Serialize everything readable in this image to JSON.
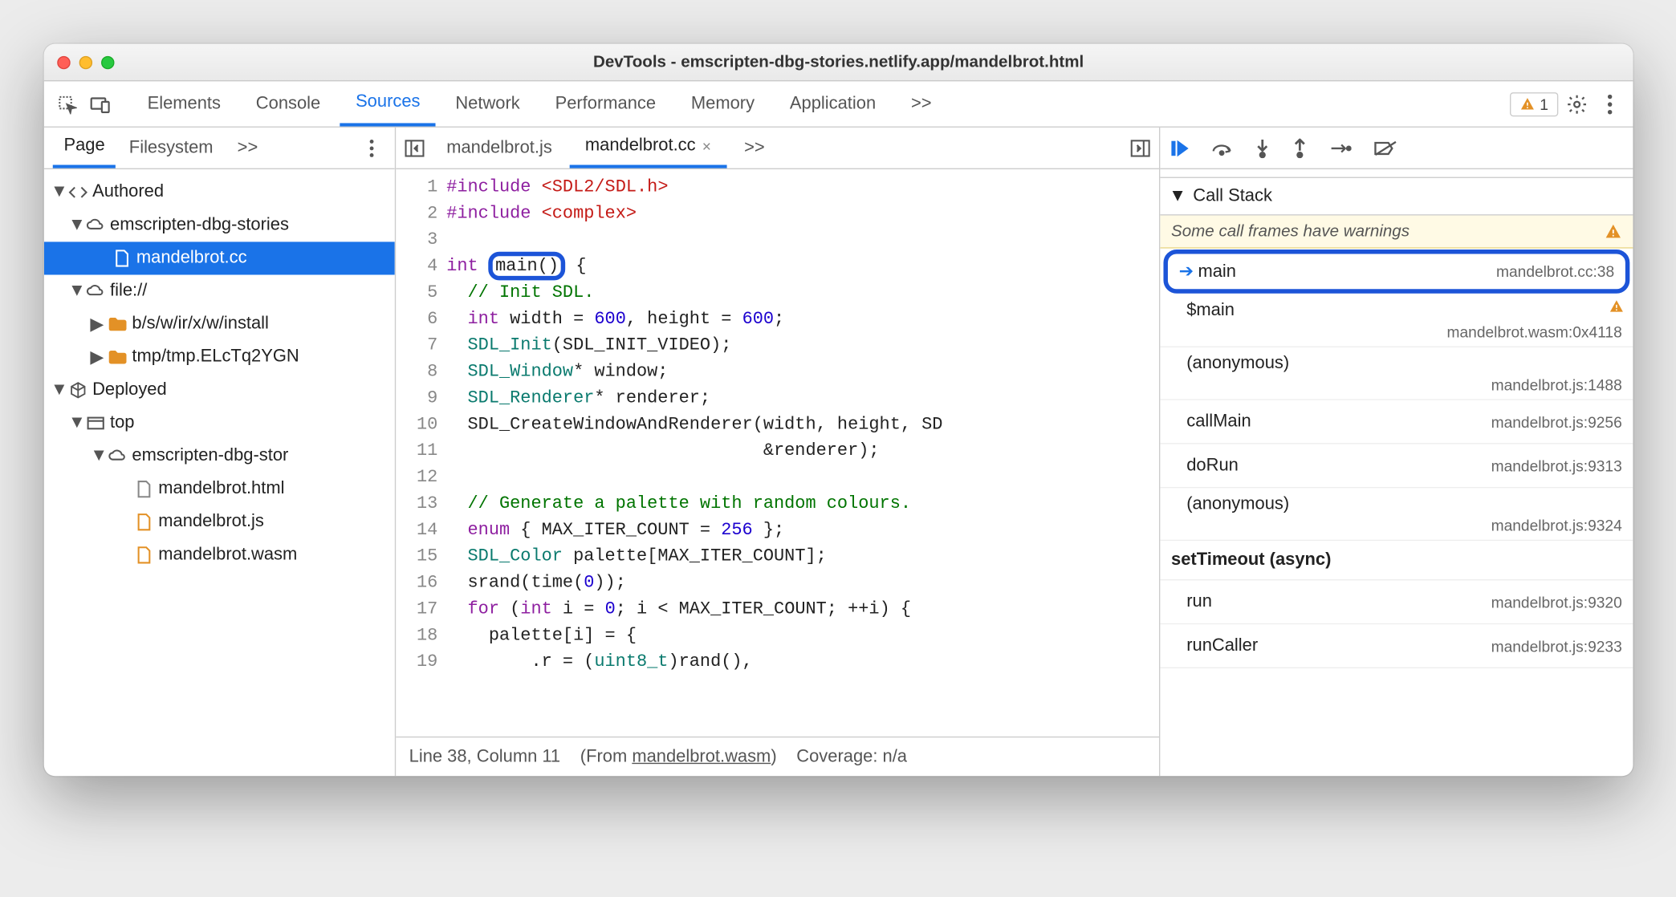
{
  "window": {
    "title": "DevTools - emscripten-dbg-stories.netlify.app/mandelbrot.html"
  },
  "topTabs": {
    "elements": "Elements",
    "console": "Console",
    "sources": "Sources",
    "network": "Network",
    "performance": "Performance",
    "memory": "Memory",
    "application": "Application",
    "more": ">>",
    "warnCount": "1"
  },
  "navTabs": {
    "page": "Page",
    "filesystem": "Filesystem",
    "more": ">>"
  },
  "tree": {
    "authored": "Authored",
    "origin1": "emscripten-dbg-stories",
    "file_mc": "mandelbrot.cc",
    "file_proto": "file://",
    "dir1": "b/s/w/ir/x/w/install",
    "dir2": "tmp/tmp.ELcTq2YGN",
    "deployed": "Deployed",
    "top": "top",
    "origin2": "emscripten-dbg-stor",
    "f_html": "mandelbrot.html",
    "f_js": "mandelbrot.js",
    "f_wasm": "mandelbrot.wasm"
  },
  "srcTabs": {
    "t1": "mandelbrot.js",
    "t2": "mandelbrot.cc",
    "more": ">>"
  },
  "code": {
    "lines": [
      "#include <SDL2/SDL.h>",
      "#include <complex>",
      "",
      "int main() {",
      "  // Init SDL.",
      "  int width = 600, height = 600;",
      "  SDL_Init(SDL_INIT_VIDEO);",
      "  SDL_Window* window;",
      "  SDL_Renderer* renderer;",
      "  SDL_CreateWindowAndRenderer(width, height, SD",
      "                              &renderer);",
      "",
      "  // Generate a palette with random colours.",
      "  enum { MAX_ITER_COUNT = 256 };",
      "  SDL_Color palette[MAX_ITER_COUNT];",
      "  srand(time(0));",
      "  for (int i = 0; i < MAX_ITER_COUNT; ++i) {",
      "    palette[i] = {",
      "        .r = (uint8_t)rand(),"
    ]
  },
  "status": {
    "pos": "Line 38, Column 11",
    "from_pre": "(From ",
    "from_link": "mandelbrot.wasm",
    "from_post": ")",
    "cov": "Coverage: n/a"
  },
  "callstack": {
    "header": "Call Stack",
    "warn": "Some call frames have warnings",
    "frames": [
      {
        "name": "main",
        "loc": "mandelbrot.cc:38",
        "current": true
      },
      {
        "name": "$main",
        "loc": "mandelbrot.wasm:0x4118",
        "warn": true
      },
      {
        "name": "(anonymous)",
        "loc": "mandelbrot.js:1488"
      },
      {
        "name": "callMain",
        "loc": "mandelbrot.js:9256"
      },
      {
        "name": "doRun",
        "loc": "mandelbrot.js:9313"
      },
      {
        "name": "(anonymous)",
        "loc": "mandelbrot.js:9324"
      }
    ],
    "async": "setTimeout (async)",
    "frames2": [
      {
        "name": "run",
        "loc": "mandelbrot.js:9320"
      },
      {
        "name": "runCaller",
        "loc": "mandelbrot.js:9233"
      }
    ]
  }
}
